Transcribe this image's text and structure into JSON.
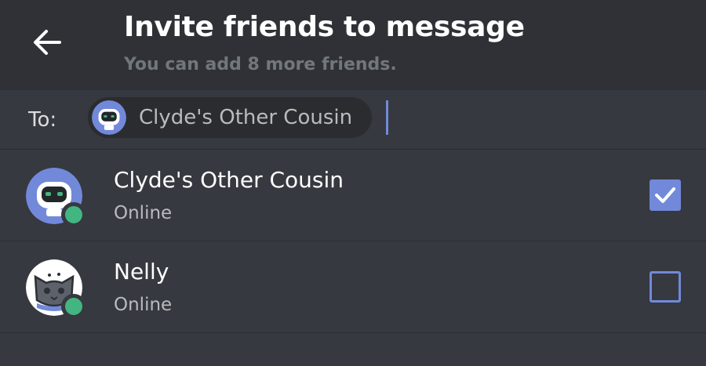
{
  "header": {
    "title": "Invite friends to message",
    "subtitle": "You can add 8 more friends.",
    "back_icon": "arrow-left-icon"
  },
  "to_field": {
    "label": "To:",
    "chips": [
      {
        "label": "Clyde's Other Cousin",
        "avatar": "robot-avatar"
      }
    ]
  },
  "friends": [
    {
      "name": "Clyde's Other Cousin",
      "status": "Online",
      "avatar": "robot-avatar",
      "selected": true
    },
    {
      "name": "Nelly",
      "status": "Online",
      "avatar": "cat-avatar",
      "selected": false
    }
  ],
  "colors": {
    "accent": "#7289da",
    "online": "#43b581",
    "background": "#36393f",
    "header_bg": "#2f3136"
  }
}
